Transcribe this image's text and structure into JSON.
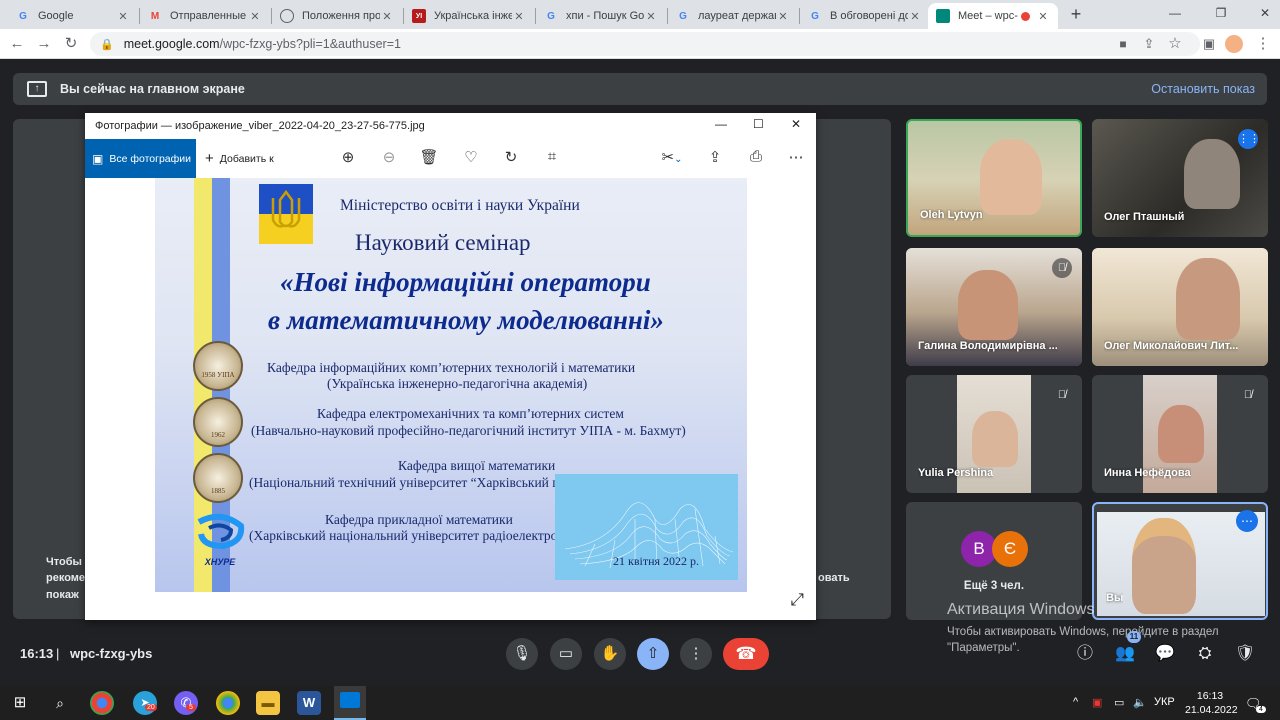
{
  "browser": {
    "tabs": [
      {
        "title": "Google",
        "icon": "google-g-icon",
        "color": "#4285f4",
        "active": false
      },
      {
        "title": "Отправленные - ",
        "icon": "gmail-icon",
        "color": "#ea4335",
        "active": false
      },
      {
        "title": "Положення про",
        "icon": "globe-icon",
        "color": "#5f6368",
        "active": false
      },
      {
        "title": "Українська інже",
        "icon": "uipa-site-icon",
        "color": "#b71c1c",
        "active": false
      },
      {
        "title": "хпи - Пошук Goo",
        "icon": "google-g-icon",
        "color": "#4285f4",
        "active": false
      },
      {
        "title": "лауреат держав",
        "icon": "google-g-icon",
        "color": "#4285f4",
        "active": false
      },
      {
        "title": "В обговорені до",
        "icon": "google-g-icon",
        "color": "#4285f4",
        "active": false
      },
      {
        "title": "Meet – wpc-",
        "icon": "meet-icon",
        "color": "#00897b",
        "active": true
      }
    ],
    "url_host": "meet.google.com",
    "url_path": "/wpc-fzxg-ybs?pli=1&authuser=1"
  },
  "banner": {
    "message": "Вы сейчас на главном экране",
    "stop_label": "Остановить показ"
  },
  "behind_text": [
    "Чтобы",
    "рекоме",
    "покаж",
    "овать"
  ],
  "photos_app": {
    "title": "Фотографии — изображение_viber_2022-04-20_23-27-56-775.jpg",
    "all_photos": "Все фотографии",
    "add_to": "Добавить к"
  },
  "slide": {
    "ministry": "Міністерство освіти і науки України",
    "seminar": "Науковий семінар",
    "title_line1": "«Нові інформаційні оператори",
    "title_line2": "в математичному моделюванні»",
    "departments": [
      {
        "line1": "Кафедра інформаційних комп’ютерних технологій і математики",
        "line2": "(Українська інженерно-педагогічна академія)",
        "seal": "1958 УІПА"
      },
      {
        "line1": "Кафедра електромеханічних та комп’ютерних систем",
        "line2": "(Навчально-науковий професійно-педагогічний інститут УІПА - м. Бахмут)",
        "seal": "1962"
      },
      {
        "line1": "Кафедра вищої математики",
        "line2": "(Національний технічний університет “Харківський політехнічний інститут”)",
        "seal": "1885"
      },
      {
        "line1": "Кафедра прикладної математики",
        "line2": "(Харківський національний університет радіоелектроніки)",
        "seal": "ХНУРЕ"
      }
    ],
    "date": "21 квітня 2022 р."
  },
  "participants": [
    {
      "name": "Oleh Lytvyn",
      "muted": false,
      "speaking_border": true
    },
    {
      "name": "Олег Пташный",
      "muted": false,
      "speaking": true
    },
    {
      "name": "Галина Володимирівна ...",
      "muted": true
    },
    {
      "name": "Олег Миколайович Лит...",
      "muted": false
    },
    {
      "name": "Yulia Pershina",
      "muted": true
    },
    {
      "name": "Инна Нефёдова",
      "muted": true
    },
    {
      "name": "Ещё 3 чел.",
      "avatars": [
        "В",
        "Є"
      ],
      "avatar_colors": [
        "#8e24aa",
        "#e8710a"
      ]
    },
    {
      "name": "Вы",
      "self": true
    }
  ],
  "windows_activation": {
    "title": "Активация Windows",
    "text": "Чтобы активировать Windows, перейдите в раздел \"Параметры\"."
  },
  "meeting": {
    "time": "16:13",
    "separator": "|",
    "code": "wpc-fzxg-ybs",
    "participant_count": "11"
  },
  "taskbar": {
    "lang": "УКР",
    "time": "16:13",
    "date": "21.04.2022",
    "badges": {
      "telegram": "20",
      "viber": "5",
      "notifications": "4"
    }
  },
  "colors": {
    "accent": "#8ab4f8",
    "leave": "#ea4335",
    "photos_blue": "#0063b1"
  }
}
